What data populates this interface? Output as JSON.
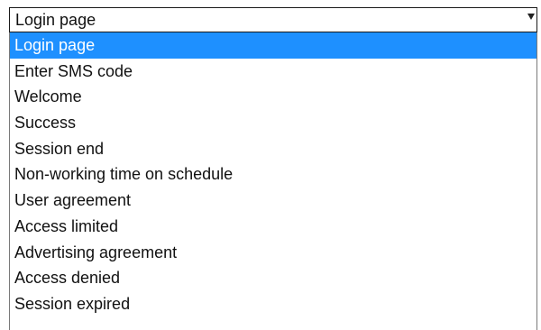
{
  "select": {
    "value": "Login page",
    "arrow_icon": "triangle-down"
  },
  "options": [
    {
      "label": "Login page",
      "selected": true
    },
    {
      "label": "Enter SMS code",
      "selected": false
    },
    {
      "label": "Welcome",
      "selected": false
    },
    {
      "label": "Success",
      "selected": false
    },
    {
      "label": "Session end",
      "selected": false
    },
    {
      "label": "Non-working time on schedule",
      "selected": false
    },
    {
      "label": "User agreement",
      "selected": false
    },
    {
      "label": "Access limited",
      "selected": false
    },
    {
      "label": "Advertising agreement",
      "selected": false
    },
    {
      "label": "Access denied",
      "selected": false
    },
    {
      "label": "Session expired",
      "selected": false
    }
  ],
  "colors": {
    "highlight": "#1e90ff",
    "highlight_text": "#ffffff",
    "text": "#111111",
    "border": "#1a1a1a"
  }
}
